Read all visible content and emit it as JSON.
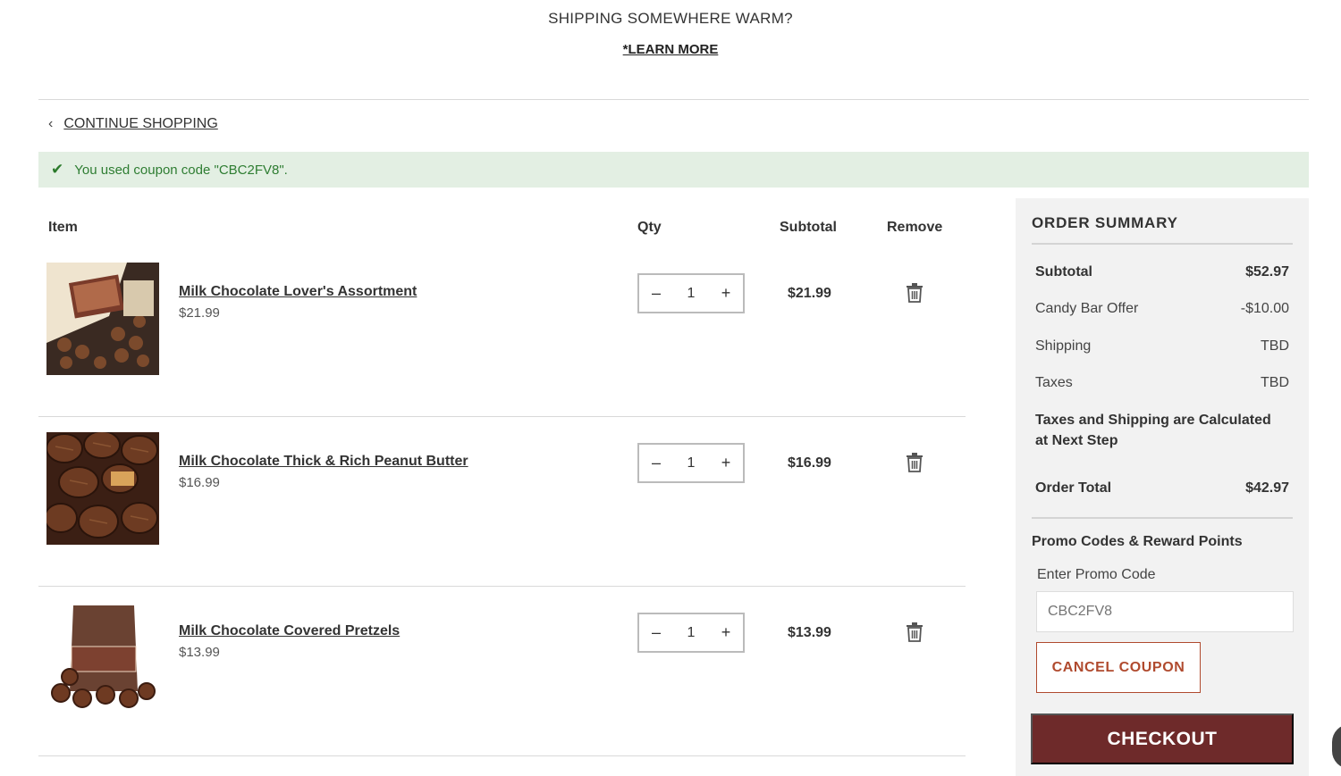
{
  "banner": {
    "title": "SHIPPING SOMEWHERE WARM?",
    "link": "*LEARN MORE"
  },
  "nav": {
    "continue_label": "CONTINUE SHOPPING"
  },
  "coupon_message": "You used coupon code \"CBC2FV8\".",
  "table": {
    "headers": {
      "item": "Item",
      "qty": "Qty",
      "subtotal": "Subtotal",
      "remove": "Remove"
    },
    "rows": [
      {
        "name": "Milk Chocolate Lover's Assortment",
        "price": "$21.99",
        "qty": "1",
        "subtotal": "$21.99"
      },
      {
        "name": "Milk Chocolate Thick & Rich Peanut Butter",
        "price": "$16.99",
        "qty": "1",
        "subtotal": "$16.99"
      },
      {
        "name": "Milk Chocolate Covered Pretzels",
        "price": "$13.99",
        "qty": "1",
        "subtotal": "$13.99"
      }
    ]
  },
  "summary": {
    "title": "ORDER SUMMARY",
    "subtotal_label": "Subtotal",
    "subtotal_value": "$52.97",
    "offer_label": "Candy Bar Offer",
    "offer_value": "-$10.00",
    "shipping_label": "Shipping",
    "shipping_value": "TBD",
    "taxes_label": "Taxes",
    "taxes_value": "TBD",
    "note": "Taxes and Shipping are Calculated at Next Step",
    "total_label": "Order Total",
    "total_value": "$42.97",
    "promo_heading": "Promo Codes & Reward Points",
    "promo_label": "Enter Promo Code",
    "promo_placeholder": "CBC2FV8",
    "cancel_coupon": "CANCEL COUPON",
    "checkout": "CHECKOUT"
  },
  "icons": {
    "minus": "minus-icon",
    "plus": "plus-icon",
    "trash": "trash-icon",
    "check": "check-icon",
    "chevron": "chevron-left-icon"
  }
}
